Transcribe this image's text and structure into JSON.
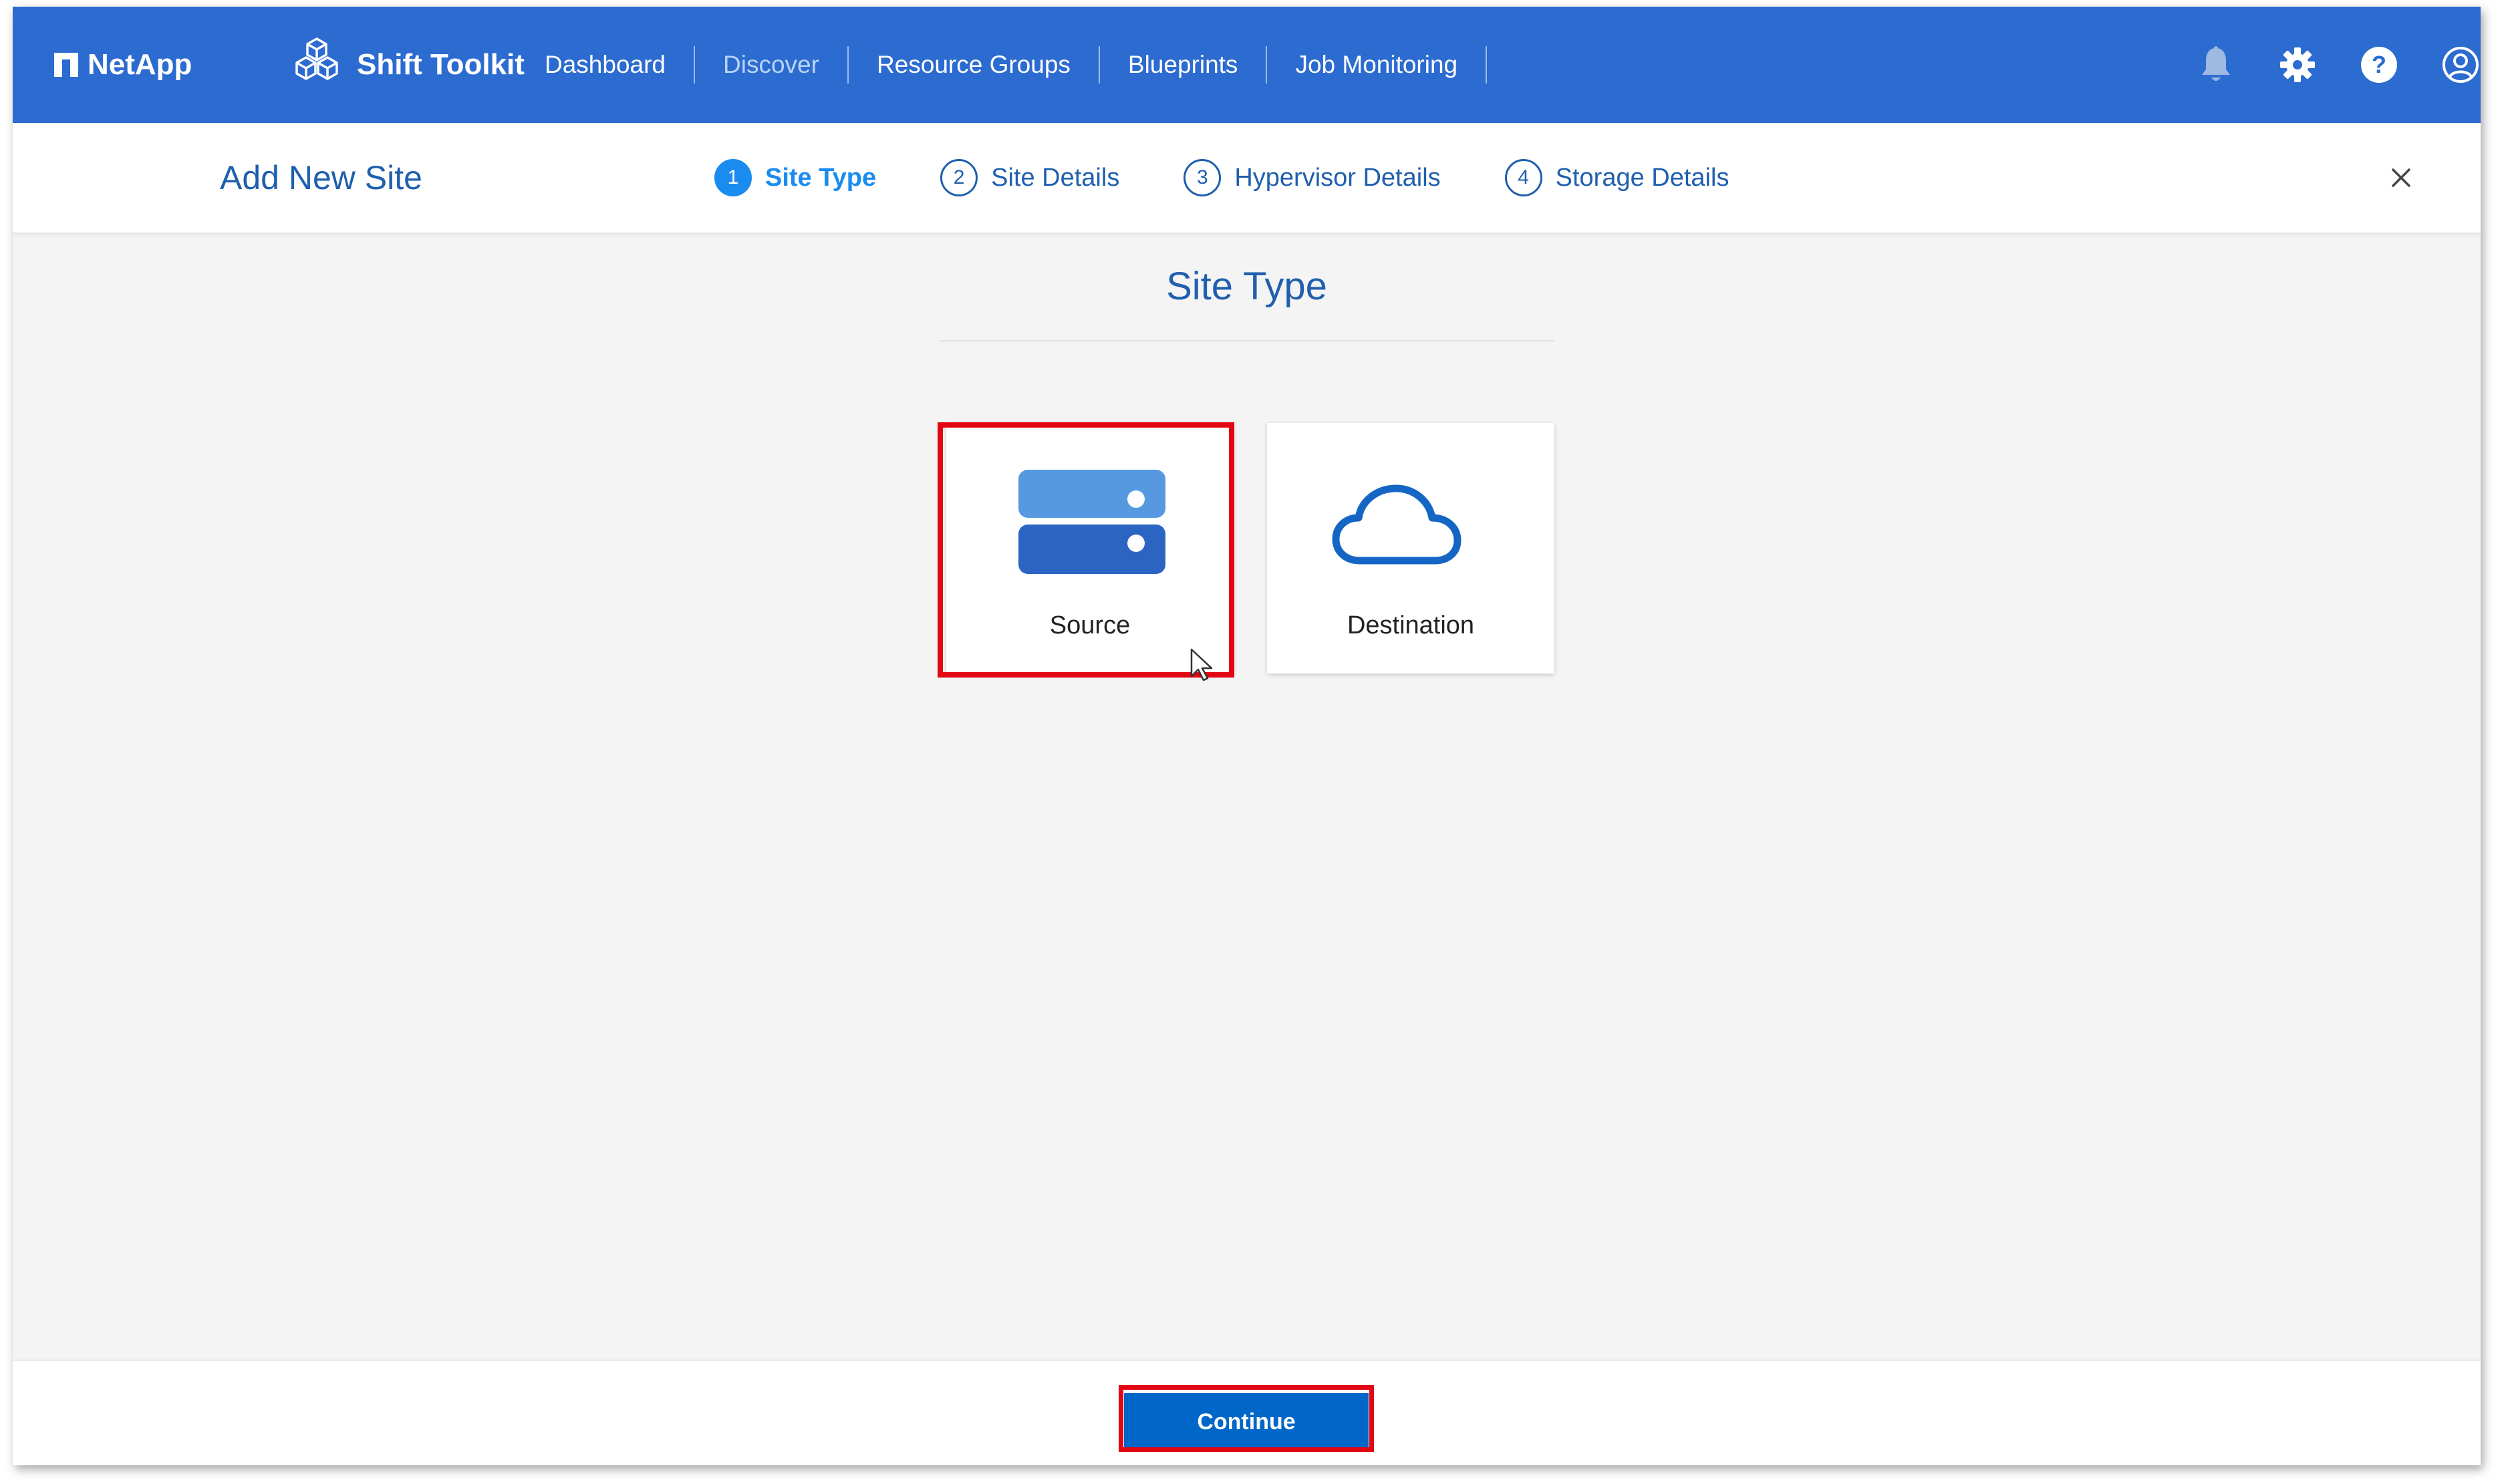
{
  "topnav": {
    "brand": "NetApp",
    "product": "Shift Toolkit",
    "items": [
      {
        "label": "Dashboard"
      },
      {
        "label": "Discover"
      },
      {
        "label": "Resource Groups"
      },
      {
        "label": "Blueprints"
      },
      {
        "label": "Job Monitoring"
      }
    ],
    "active_item": "Discover",
    "icons": [
      "bell-icon",
      "gear-icon",
      "help-icon",
      "user-icon"
    ]
  },
  "subheader": {
    "title": "Add New Site",
    "steps": [
      {
        "number": "1",
        "label": "Site Type"
      },
      {
        "number": "2",
        "label": "Site Details"
      },
      {
        "number": "3",
        "label": "Hypervisor Details"
      },
      {
        "number": "4",
        "label": "Storage Details"
      }
    ],
    "active_step": "Site Type"
  },
  "main": {
    "section_title": "Site Type",
    "options": [
      {
        "label": "Source",
        "icon": "server-icon"
      },
      {
        "label": "Destination",
        "icon": "cloud-icon"
      }
    ],
    "selected_option": "Source"
  },
  "footer": {
    "continue_label": "Continue"
  },
  "colors": {
    "nav_bg": "#2c6bd0",
    "accent": "#1f5fae",
    "active_step": "#1a8cf0",
    "button": "#0066c8",
    "highlight": "#e30613"
  }
}
